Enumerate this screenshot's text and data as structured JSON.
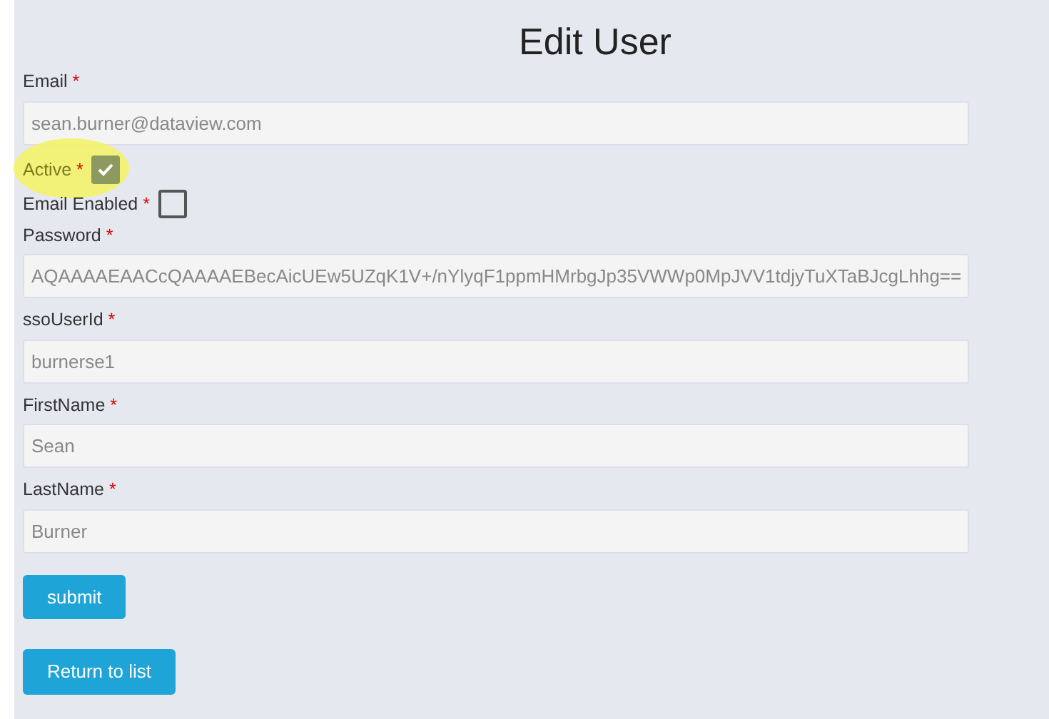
{
  "title": "Edit User",
  "fields": [
    {
      "kind": "text",
      "label": "Email",
      "required": "*",
      "value": "sean.burner@dataview.com"
    },
    {
      "kind": "checkbox",
      "label": "Active",
      "required": "*",
      "checked": true,
      "highlighted": true
    },
    {
      "kind": "checkbox",
      "label": "Email Enabled",
      "required": "*",
      "checked": false,
      "highlighted": false
    },
    {
      "kind": "text",
      "label": "Password",
      "required": "*",
      "value": "AQAAAAEAACcQAAAAEBecAicUEw5UZqK1V+/nYlyqF1ppmHMrbgJp35VWWp0MpJVV1tdjyTuXTaBJcgLhhg=="
    },
    {
      "kind": "text",
      "label": "ssoUserId",
      "required": "*",
      "value": "burnerse1"
    },
    {
      "kind": "text",
      "label": "FirstName",
      "required": "*",
      "value": "Sean"
    },
    {
      "kind": "text",
      "label": "LastName",
      "required": "*",
      "value": "Burner"
    }
  ],
  "buttons": [
    "submit",
    "Return to list"
  ]
}
